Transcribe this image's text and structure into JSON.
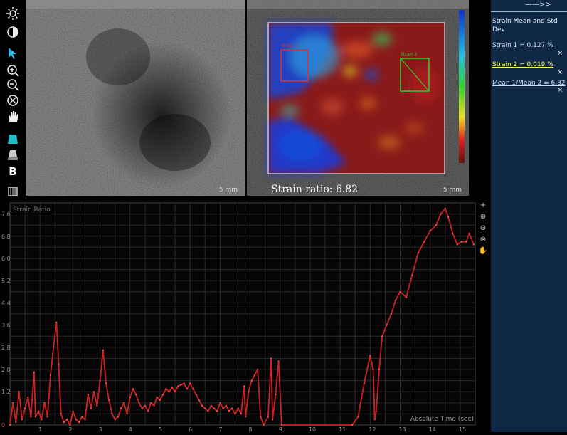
{
  "toolbar": {
    "icons": [
      "brightness-icon",
      "contrast-icon",
      "pointer-icon",
      "zoom-in-icon",
      "zoom-out-icon",
      "zoom-reset-icon",
      "pan-hand-icon",
      "elasto-mode-icon",
      "dual-mode-icon",
      "b-mode-icon",
      "settings-icon"
    ],
    "b_label": "B"
  },
  "images": {
    "left_scale": "5 mm",
    "right_scale": "5 mm",
    "roi1_label": "Strain 1",
    "roi2_label": "Strain 2"
  },
  "ratio_text": "Strain ratio: 6.82",
  "panel": {
    "arrows": "——>>",
    "title": "Strain Mean and Std Dev",
    "items": [
      {
        "text": "Strain 1 = 0.127 %",
        "active": false
      },
      {
        "text": "Strain 2 = 0.019 %",
        "active": true
      },
      {
        "text": "Mean 1/Mean 2 = 6.82",
        "active": false
      }
    ],
    "close": "×"
  },
  "colors": {
    "graph_line": "#cc2222",
    "grid": "#2a2a2a",
    "roi1": "#dd3030",
    "roi2": "#33cc33",
    "panel_bg": "#0f2846",
    "active_item": "#ffff55"
  },
  "chart_data": {
    "type": "line",
    "title": "Strain Ratio",
    "xlabel": "Absolute Time (sec)",
    "ylabel": "",
    "xlim": [
      0,
      15.5
    ],
    "ylim": [
      0,
      8.0
    ],
    "x_ticks": [
      1,
      2,
      3,
      4,
      5,
      6,
      7,
      8,
      9,
      10,
      11,
      12,
      13,
      14,
      15
    ],
    "y_ticks": [
      "0",
      "1.2",
      "2.0",
      "2.8",
      "3.6",
      "4.4",
      "5.2",
      "6.0",
      "6.8",
      "7.6"
    ],
    "y_tick_values": [
      0,
      1.2,
      2.0,
      2.8,
      3.6,
      4.4,
      5.2,
      6.0,
      6.8,
      7.6
    ],
    "series": [
      {
        "points": [
          [
            0,
            0
          ],
          [
            0.1,
            0.8
          ],
          [
            0.2,
            0.1
          ],
          [
            0.3,
            1.2
          ],
          [
            0.4,
            0.2
          ],
          [
            0.5,
            0.6
          ],
          [
            0.6,
            1.0
          ],
          [
            0.7,
            0.3
          ],
          [
            0.8,
            1.9
          ],
          [
            0.85,
            0.3
          ],
          [
            0.95,
            0.5
          ],
          [
            1.05,
            0.2
          ],
          [
            1.15,
            0.8
          ],
          [
            1.25,
            0.3
          ],
          [
            1.35,
            1.8
          ],
          [
            1.45,
            2.8
          ],
          [
            1.55,
            3.7
          ],
          [
            1.62,
            2.2
          ],
          [
            1.7,
            0.4
          ],
          [
            1.8,
            0.1
          ],
          [
            1.9,
            0.2
          ],
          [
            2.0,
            0.0
          ],
          [
            2.1,
            0.5
          ],
          [
            2.2,
            0.2
          ],
          [
            2.3,
            0.1
          ],
          [
            2.4,
            0.3
          ],
          [
            2.5,
            0.2
          ],
          [
            2.6,
            1.1
          ],
          [
            2.7,
            0.6
          ],
          [
            2.8,
            1.2
          ],
          [
            2.9,
            0.7
          ],
          [
            3.0,
            1.6
          ],
          [
            3.1,
            2.7
          ],
          [
            3.2,
            1.5
          ],
          [
            3.3,
            0.9
          ],
          [
            3.4,
            0.4
          ],
          [
            3.5,
            0.2
          ],
          [
            3.6,
            0.3
          ],
          [
            3.7,
            0.6
          ],
          [
            3.8,
            0.8
          ],
          [
            3.9,
            0.4
          ],
          [
            4.0,
            1.0
          ],
          [
            4.1,
            1.3
          ],
          [
            4.2,
            1.1
          ],
          [
            4.3,
            0.8
          ],
          [
            4.4,
            0.6
          ],
          [
            4.5,
            0.7
          ],
          [
            4.6,
            0.5
          ],
          [
            4.7,
            0.8
          ],
          [
            4.8,
            0.7
          ],
          [
            4.9,
            1.0
          ],
          [
            5.0,
            0.9
          ],
          [
            5.1,
            1.1
          ],
          [
            5.2,
            1.3
          ],
          [
            5.3,
            1.2
          ],
          [
            5.4,
            1.35
          ],
          [
            5.5,
            1.2
          ],
          [
            5.6,
            1.4
          ],
          [
            5.7,
            1.45
          ],
          [
            5.8,
            1.5
          ],
          [
            5.9,
            1.3
          ],
          [
            6.0,
            1.5
          ],
          [
            6.1,
            1.3
          ],
          [
            6.2,
            1.1
          ],
          [
            6.3,
            0.9
          ],
          [
            6.4,
            0.7
          ],
          [
            6.5,
            0.6
          ],
          [
            6.6,
            0.5
          ],
          [
            6.7,
            0.7
          ],
          [
            6.8,
            0.6
          ],
          [
            6.9,
            0.5
          ],
          [
            7.0,
            0.8
          ],
          [
            7.1,
            0.6
          ],
          [
            7.2,
            0.7
          ],
          [
            7.3,
            0.5
          ],
          [
            7.4,
            0.6
          ],
          [
            7.5,
            0.4
          ],
          [
            7.6,
            0.6
          ],
          [
            7.7,
            0.4
          ],
          [
            7.8,
            1.4
          ],
          [
            7.85,
            0.3
          ],
          [
            7.95,
            1.2
          ],
          [
            8.05,
            1.6
          ],
          [
            8.15,
            1.8
          ],
          [
            8.25,
            2.0
          ],
          [
            8.35,
            0.3
          ],
          [
            8.45,
            0.0
          ],
          [
            8.6,
            0.3
          ],
          [
            8.7,
            2.4
          ],
          [
            8.75,
            0.2
          ],
          [
            8.85,
            1.1
          ],
          [
            8.95,
            2.3
          ],
          [
            9.05,
            0.0
          ],
          [
            11.4,
            0.0
          ],
          [
            11.6,
            0.3
          ],
          [
            11.8,
            1.5
          ],
          [
            12.0,
            2.5
          ],
          [
            12.1,
            2.0
          ],
          [
            12.15,
            0.2
          ],
          [
            12.2,
            0.5
          ],
          [
            12.3,
            2.0
          ],
          [
            12.4,
            3.2
          ],
          [
            12.55,
            3.6
          ],
          [
            12.7,
            4.0
          ],
          [
            12.85,
            4.5
          ],
          [
            13.0,
            4.8
          ],
          [
            13.2,
            4.6
          ],
          [
            13.4,
            5.4
          ],
          [
            13.6,
            6.2
          ],
          [
            13.8,
            6.6
          ],
          [
            14.0,
            7.0
          ],
          [
            14.2,
            7.2
          ],
          [
            14.35,
            7.6
          ],
          [
            14.5,
            7.8
          ],
          [
            14.6,
            7.5
          ],
          [
            14.75,
            6.9
          ],
          [
            14.9,
            6.5
          ],
          [
            15.05,
            6.6
          ],
          [
            15.2,
            6.6
          ],
          [
            15.3,
            6.9
          ],
          [
            15.45,
            6.5
          ]
        ]
      }
    ]
  }
}
